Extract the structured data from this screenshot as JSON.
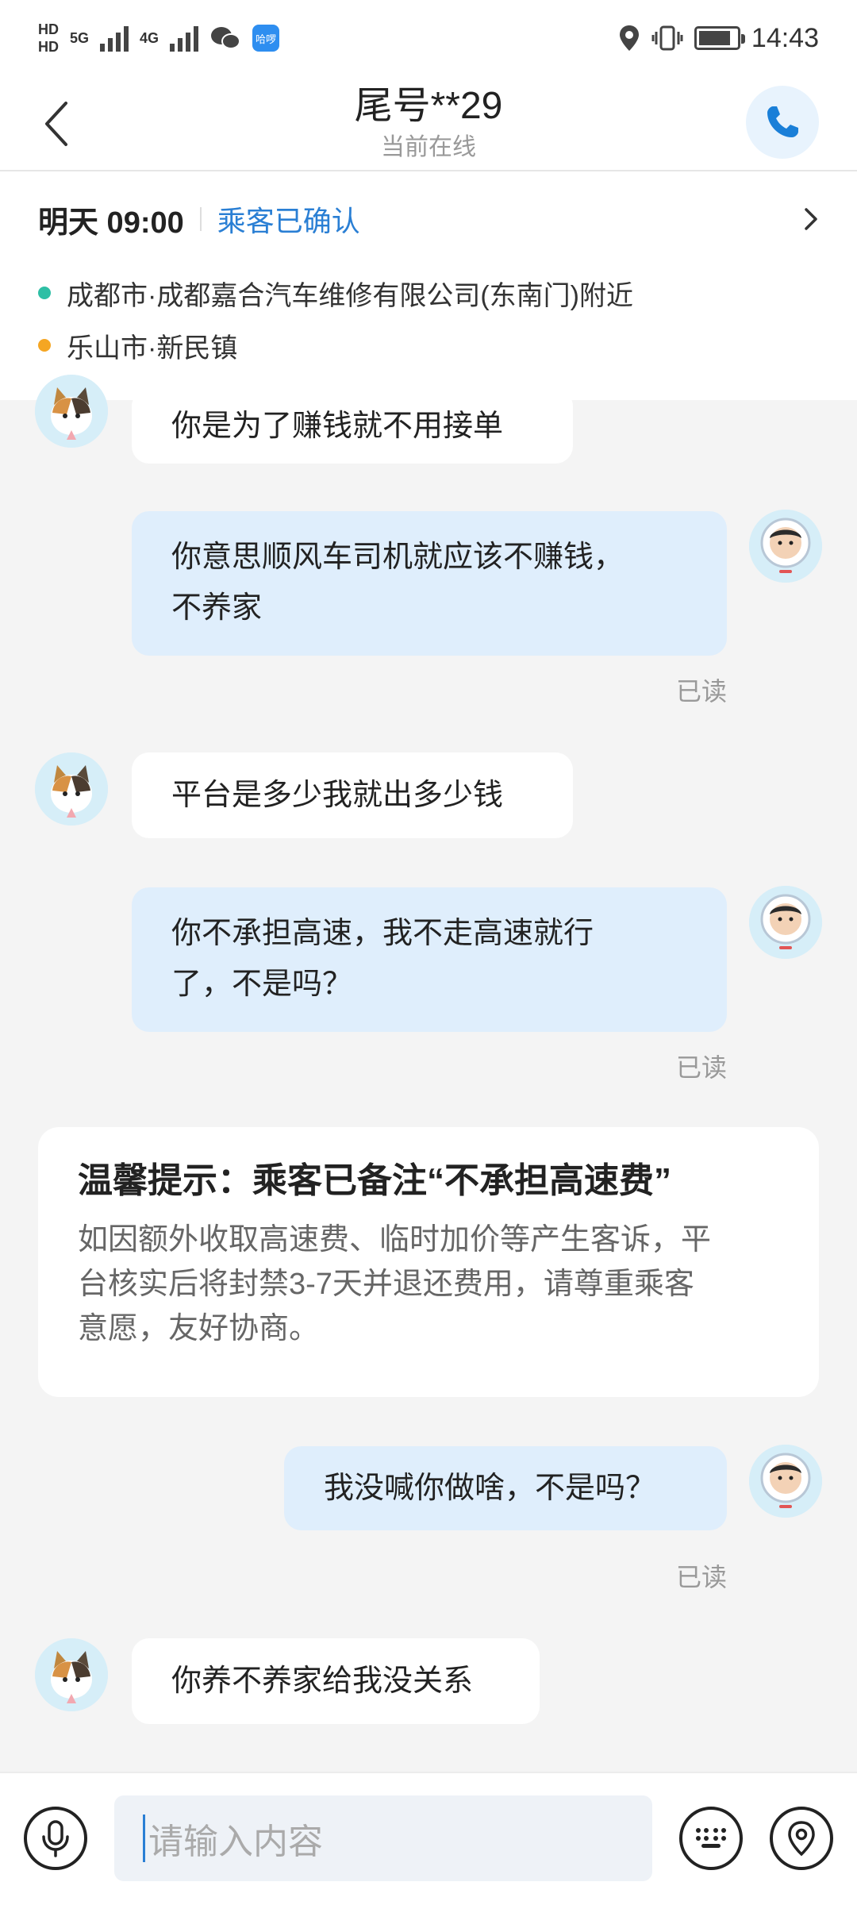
{
  "status_bar": {
    "network_1": "HD",
    "network_2": "HD",
    "gen_1": "5G",
    "gen_2": "4G",
    "app_badge": "哈啰",
    "time": "14:43",
    "battery_level": 0.85
  },
  "header": {
    "title": "尾号**29",
    "subtitle": "当前在线"
  },
  "trip": {
    "time": "明天 09:00",
    "status": "乘客已确认",
    "from": "成都市·成都嘉合汽车维修有限公司(东南门)附近",
    "to": "乐山市·新民镇",
    "from_color": "#2ebfa5",
    "to_color": "#f5a623"
  },
  "messages": [
    {
      "side": "in",
      "text": "你是为了赚钱就不用接单"
    },
    {
      "side": "out",
      "line1": "你意思顺风车司机就应该不赚钱，",
      "line2": "不养家",
      "read": "已读"
    },
    {
      "side": "in",
      "text": "平台是多少我就出多少钱"
    },
    {
      "side": "out",
      "line1": "你不承担高速，我不走高速就行",
      "line2": "了，不是吗？",
      "read": "已读"
    },
    {
      "side": "out",
      "text": "我没喊你做啥，不是吗？",
      "read": "已读"
    },
    {
      "side": "in",
      "text": "你养不养家给我没关系"
    }
  ],
  "notice": {
    "title": "温馨提示：乘客已备注“不承担高速费”",
    "line1": "如因额外收取高速费、临时加价等产生客诉，平",
    "line2": "台核实后将封禁3-7天并退还费用，请尊重乘客",
    "line3": "意愿，友好协商。"
  },
  "input": {
    "placeholder": "请输入内容"
  },
  "colors": {
    "accent": "#2a7fd4",
    "outgoing_bubble": "#dfeefc"
  }
}
